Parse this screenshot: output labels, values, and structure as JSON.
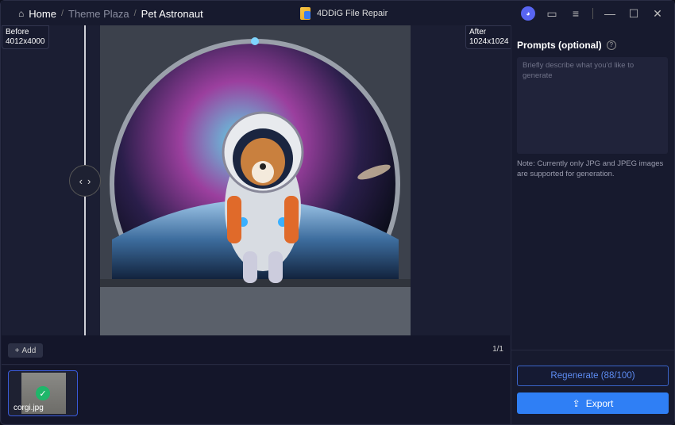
{
  "breadcrumb": {
    "home": "Home",
    "items": [
      "Theme Plaza",
      "Pet Astronaut"
    ],
    "separator": "/"
  },
  "app": {
    "title": "4DDiG File Repair"
  },
  "compare": {
    "before_label": "Before",
    "before_size": "4012x4000",
    "after_label": "After",
    "after_size": "1024x1024"
  },
  "toolbar": {
    "add_label": "Add",
    "page_count": "1/1"
  },
  "thumbnails": [
    {
      "name": "corgi.jpg",
      "selected": true
    }
  ],
  "panel": {
    "title": "Prompts (optional)",
    "prompt_placeholder": "Briefly describe what you'd like to generate",
    "prompt_value": "",
    "note": "Note: Currently only JPG and JPEG images are supported for generation.",
    "regenerate_label": "Regenerate (88/100)",
    "export_label": "Export"
  },
  "colors": {
    "accent": "#2f7ff5",
    "success": "#1fb66a",
    "background": "#171a2e"
  }
}
